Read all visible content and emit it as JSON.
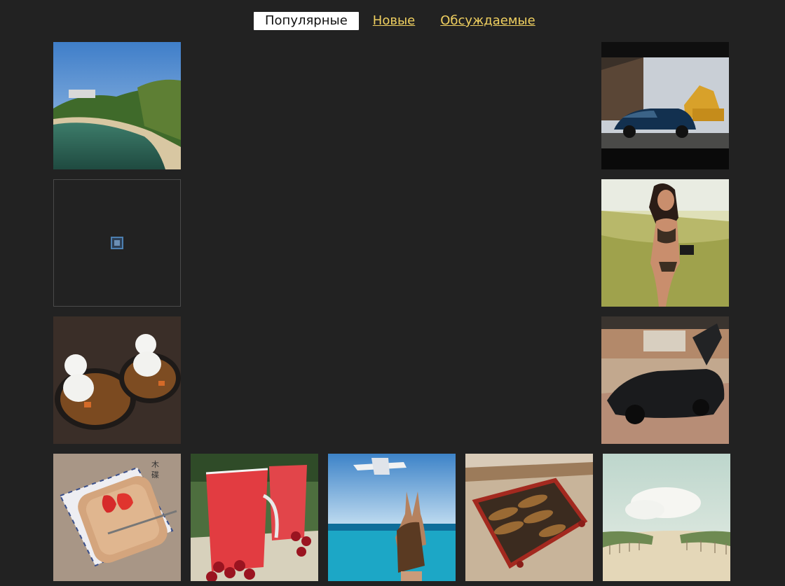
{
  "nav": {
    "tabs": [
      {
        "label": "Популярные",
        "active": true
      },
      {
        "label": "Новые",
        "active": false
      },
      {
        "label": "Обсуждаемые",
        "active": false
      }
    ]
  },
  "gallery": {
    "items": [
      {
        "subject": "beach-resort-photo"
      },
      {
        "subject": "blue-car-excavator-photo"
      },
      {
        "subject": "broken-image-icon"
      },
      {
        "subject": "woman-camera-beach-photo"
      },
      {
        "subject": "rice-curry-bowls-photo"
      },
      {
        "subject": "black-supercar-photo"
      },
      {
        "subject": "strawberries-plate-photo",
        "caption": "木 碟"
      },
      {
        "subject": "red-drink-cranberries-photo"
      },
      {
        "subject": "plane-beach-photo"
      },
      {
        "subject": "shoe-rack-photo"
      },
      {
        "subject": "sand-dune-path-photo"
      }
    ]
  },
  "colors": {
    "background": "#222222",
    "tab_link": "#f0d060",
    "tab_active_bg": "#ffffff"
  }
}
